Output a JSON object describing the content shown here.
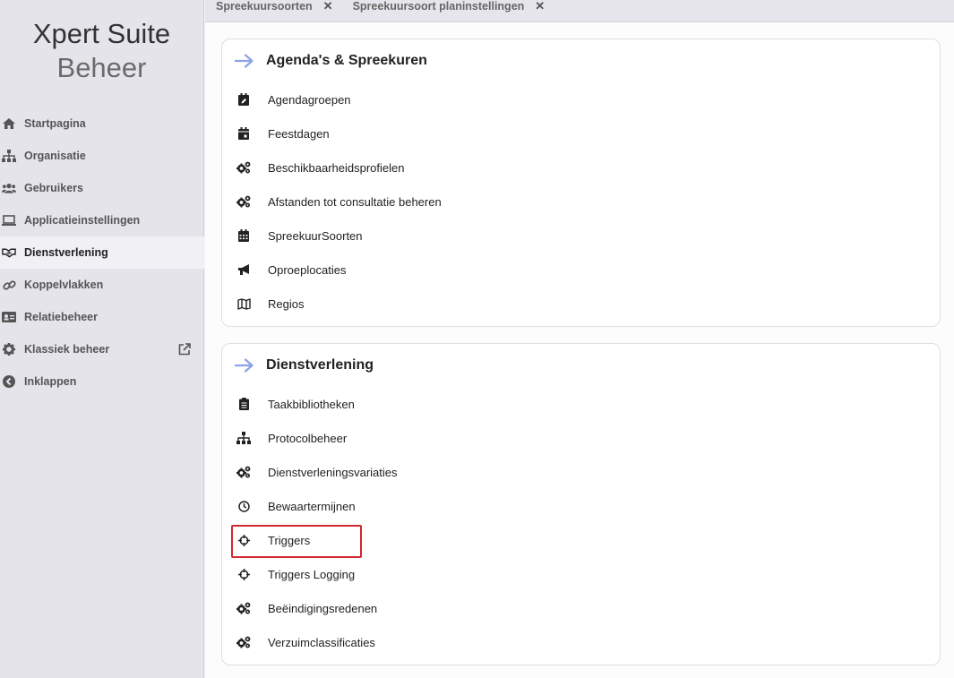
{
  "brand": {
    "line1": "Xpert Suite",
    "line2": "Beheer"
  },
  "sidebar": {
    "items": [
      {
        "label": "Startpagina",
        "icon": "home-icon"
      },
      {
        "label": "Organisatie",
        "icon": "sitemap-icon"
      },
      {
        "label": "Gebruikers",
        "icon": "users-icon"
      },
      {
        "label": "Applicatieinstellingen",
        "icon": "laptop-icon"
      },
      {
        "label": "Dienstverlening",
        "icon": "handshake-icon",
        "active": true
      },
      {
        "label": "Koppelvlakken",
        "icon": "link-icon"
      },
      {
        "label": "Relatiebeheer",
        "icon": "id-card-icon"
      },
      {
        "label": "Klassiek beheer",
        "icon": "gear-icon",
        "external": true
      },
      {
        "label": "Inklappen",
        "icon": "chevron-left-circle-icon"
      }
    ]
  },
  "tabs": [
    {
      "label": "Spreekuursoorten",
      "close": "✕"
    },
    {
      "label": "Spreekuursoort planinstellingen",
      "close": "✕"
    }
  ],
  "cards": [
    {
      "title": "Agenda's & Spreekuren",
      "items": [
        {
          "label": "Agendagroepen",
          "icon": "calendar-edit-icon"
        },
        {
          "label": "Feestdagen",
          "icon": "calendar-day-icon"
        },
        {
          "label": "Beschikbaarheidsprofielen",
          "icon": "cogs-icon"
        },
        {
          "label": "Afstanden tot consultatie beheren",
          "icon": "cogs-icon"
        },
        {
          "label": "SpreekuurSoorten",
          "icon": "calendar-grid-icon"
        },
        {
          "label": "Oproeplocaties",
          "icon": "bullhorn-icon"
        },
        {
          "label": "Regios",
          "icon": "map-icon"
        }
      ]
    },
    {
      "title": "Dienstverlening",
      "items": [
        {
          "label": "Taakbibliotheken",
          "icon": "clipboard-icon"
        },
        {
          "label": "Protocolbeheer",
          "icon": "sitemap-icon"
        },
        {
          "label": "Dienstverleningsvariaties",
          "icon": "cogs-icon"
        },
        {
          "label": "Bewaartermijnen",
          "icon": "clock-icon"
        },
        {
          "label": "Triggers",
          "icon": "crosshairs-icon",
          "highlighted": true
        },
        {
          "label": "Triggers Logging",
          "icon": "crosshairs-icon"
        },
        {
          "label": "Beëindigingsredenen",
          "icon": "cogs-icon"
        },
        {
          "label": "Verzuimclassificaties",
          "icon": "cogs-icon"
        }
      ]
    }
  ],
  "colors": {
    "accent_arrow": "#8aa3e6",
    "highlight": "#d0282e",
    "sidebar_bg": "#e5e4ea"
  }
}
